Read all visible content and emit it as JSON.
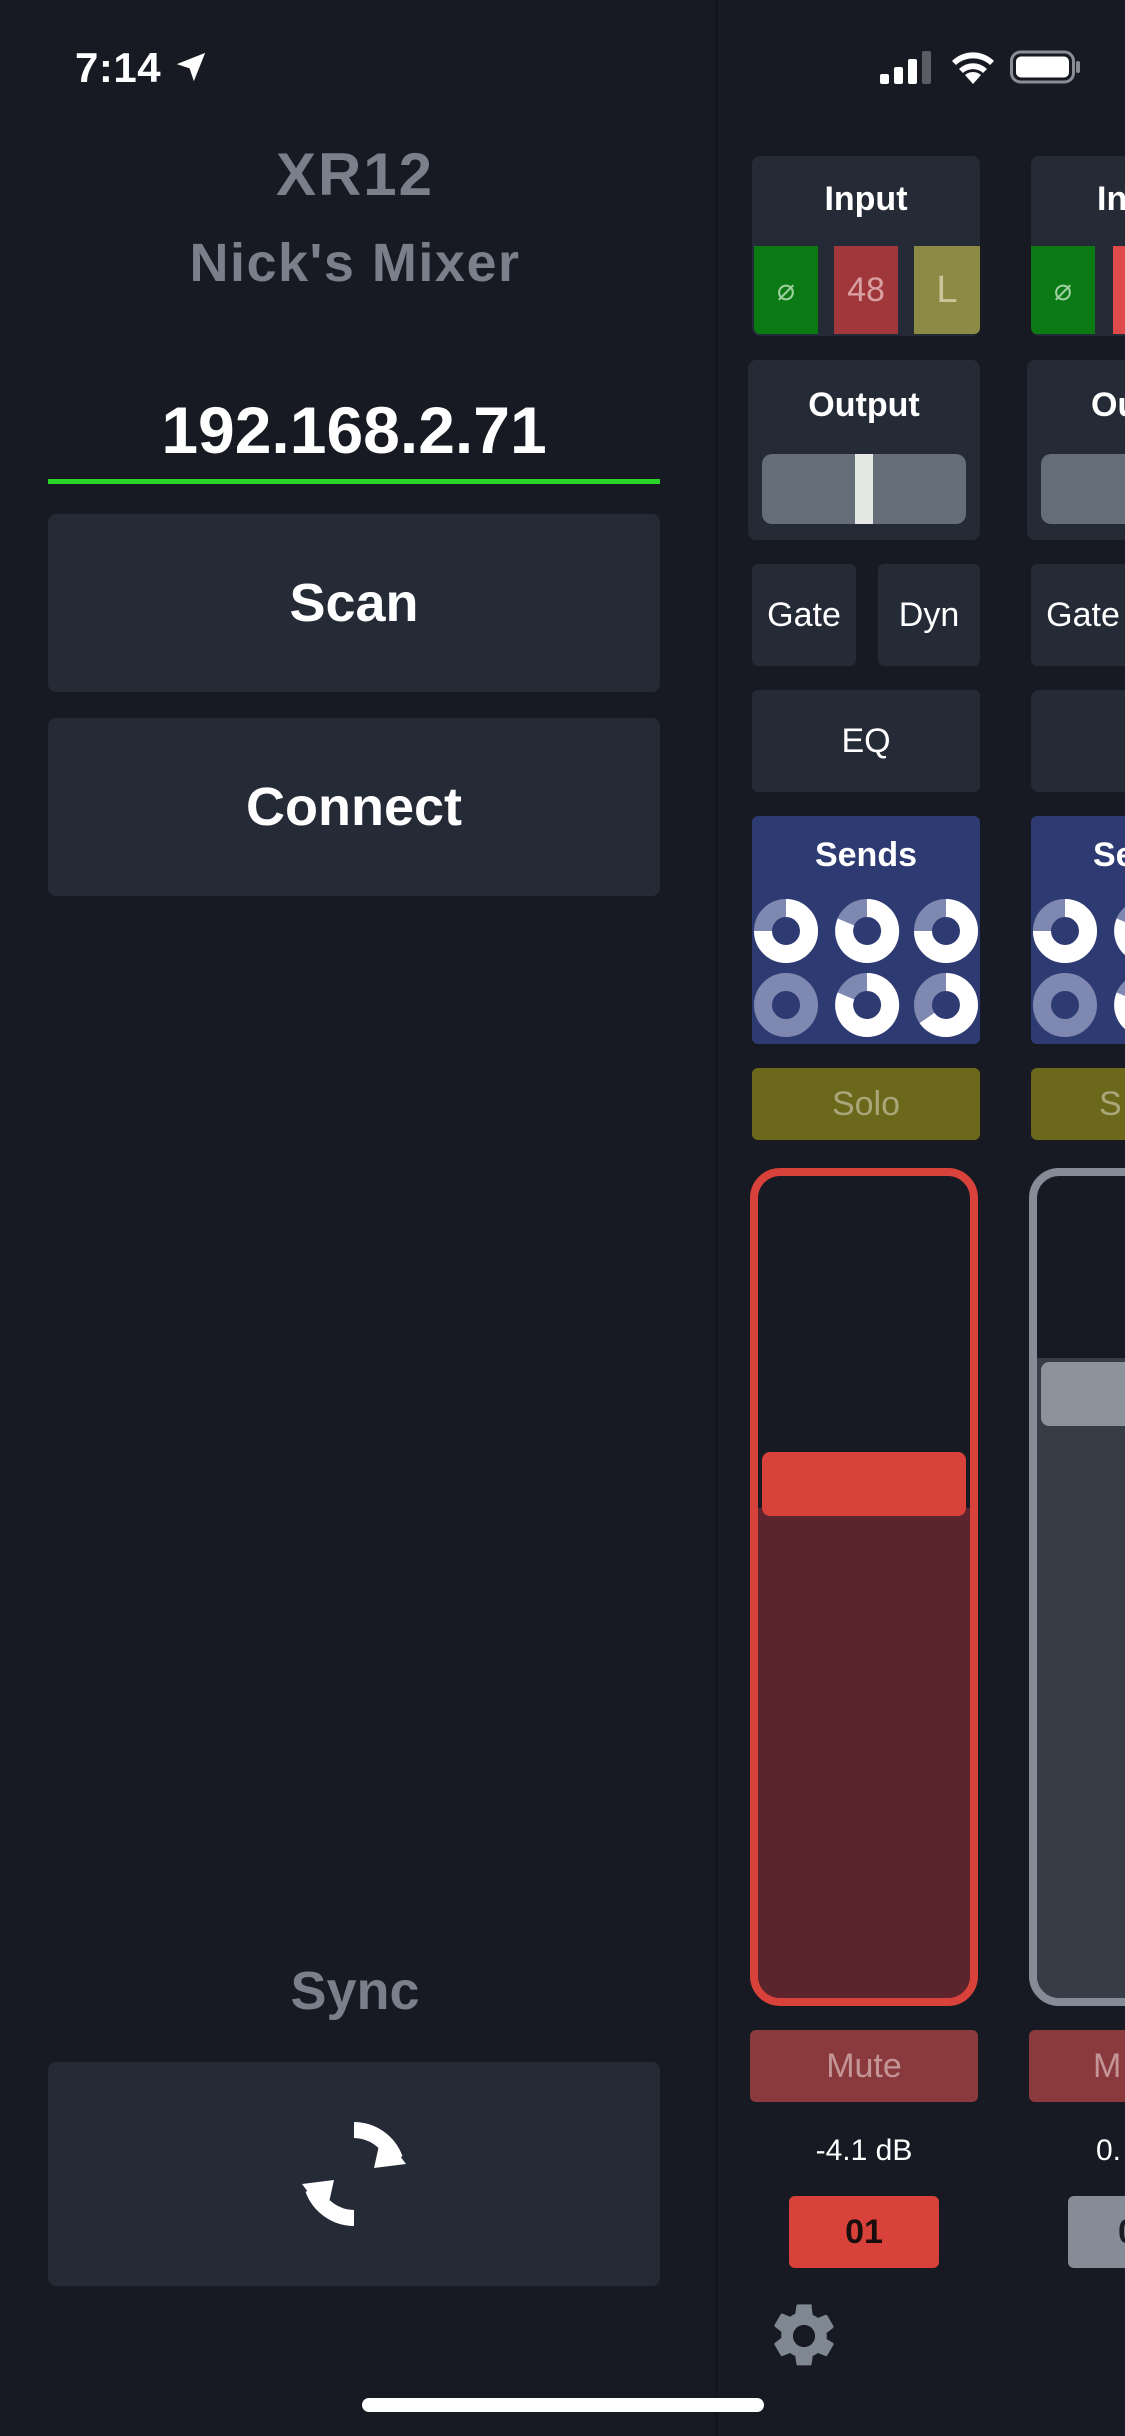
{
  "status_bar": {
    "time": "7:14"
  },
  "connection": {
    "model": "XR12",
    "name": "Nick's Mixer",
    "ip_value": "192.168.2.71",
    "scan_label": "Scan",
    "connect_label": "Connect",
    "sync_label": "Sync"
  },
  "channels": [
    {
      "input_label": "Input",
      "phase_symbol": "⌀",
      "phantom_label": "48",
      "lowcut_label": "L",
      "output_label": "Output",
      "gate_label": "Gate",
      "dyn_label": "Dyn",
      "eq_label": "EQ",
      "sends_label": "Sends",
      "solo_label": "Solo",
      "mute_label": "Mute",
      "level": "-4.1 dB",
      "number": "01",
      "fader_level": 0.65,
      "accent": "#d9423a"
    },
    {
      "input_label": "In",
      "phase_symbol": "⌀",
      "output_label": "Ou",
      "gate_label": "Gate",
      "sends_label": "Se",
      "solo_label": "S",
      "mute_label": "M",
      "level": "0.",
      "number": "0",
      "accent": "#868c97"
    }
  ],
  "colors": {
    "background": "#171a22",
    "button": "#252a37",
    "ip_underline": "#2ad52a",
    "phase_active": "#0b7a14",
    "phantom": "#a0373a",
    "lowcut": "#8d8a45",
    "sends": "#2e3a72",
    "solo": "#6c681b",
    "mute": "#8a3a3d",
    "fader_active": "#d9423a",
    "fader_fill": "#5c252d"
  },
  "icons": {
    "location": "location-arrow-icon",
    "signal": "cellular-signal-icon",
    "wifi": "wifi-icon",
    "battery": "battery-icon",
    "sync": "sync-icon",
    "settings": "gear-icon"
  }
}
